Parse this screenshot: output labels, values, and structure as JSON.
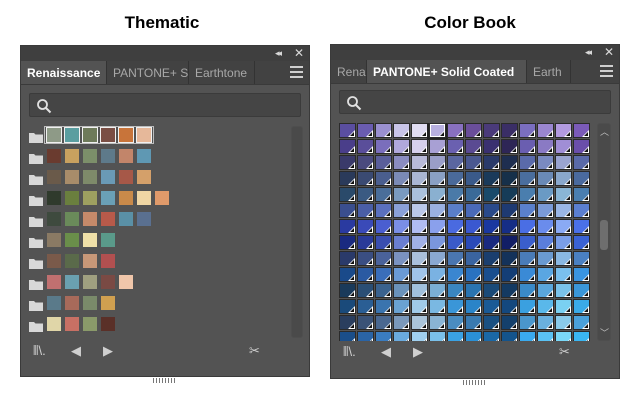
{
  "captions": {
    "left": "Thematic",
    "right": "Color Book"
  },
  "thematic": {
    "tabs": [
      "Renaissance",
      "PANTONE+ S",
      "Earthtone"
    ],
    "active_tab": 0,
    "icons": {
      "collapse": "double-chevron-icon",
      "close": "close-icon",
      "menu": "hamburger-menu-icon",
      "search": "search-icon"
    },
    "rows": [
      [
        "#8e9a87",
        "#5a9ea0",
        "#6e7a5a",
        "#7a4e44",
        "#c8743a",
        "#e6b89a"
      ],
      [
        "#6a3b2f",
        "#c8a15f",
        "#7c8f6a",
        "#5e7a8a",
        "#c2856a",
        "#5f98b3"
      ],
      [
        "#6a5a4a",
        "#a88c6a",
        "#7e8a6a",
        "#6a9ab6",
        "#a65848",
        "#d4a06a"
      ],
      [
        "#2f3a2c",
        "#6a7f3e",
        "#9ea060",
        "#6aa0b6",
        "#c98a4a",
        "#f0d6a4",
        "#e09a6a"
      ],
      [
        "#3e4a3e",
        "#6a8a5a",
        "#c68a6a",
        "#b85a4a",
        "#5a90a6",
        "#5a7090"
      ],
      [
        "#8a7a64",
        "#6a8e4a",
        "#f0e0a8",
        "#5a9a8a"
      ],
      [
        "#7a5a4a",
        "#5a6a4a",
        "#c89878",
        "#b25050"
      ],
      [
        "#c07070",
        "#6aa0b0",
        "#a0a080",
        "#7a4a44",
        "#f0c6aa"
      ],
      [
        "#5a7a8a",
        "#a86a5a",
        "#7a8a6a",
        "#d0a050"
      ],
      [
        "#e0d6a8",
        "#c87064",
        "#8a9a6a",
        "#5a3028"
      ]
    ]
  },
  "colorbook": {
    "tabs": [
      "Rena",
      "PANTONE+ Solid Coated",
      "Earth"
    ],
    "active_tab": 1,
    "icons": {
      "collapse": "double-chevron-icon",
      "close": "close-icon",
      "menu": "hamburger-menu-icon",
      "search": "search-icon"
    },
    "palette": [
      [
        "#5a4ea0",
        "#6a5cb0",
        "#9a90d0",
        "#c8c4e8",
        "#e0dcf2",
        "#b8b0e0",
        "#8870c0",
        "#6a4e9a",
        "#4a3a7a",
        "#3a2e66",
        "#7a6ec0",
        "#9a86d0",
        "#b29ae0",
        "#7a5ab8"
      ],
      [
        "#4a3e8a",
        "#5a4e9a",
        "#7a6ebc",
        "#b0a8dc",
        "#d6d0ec",
        "#a8a0d4",
        "#6a60b0",
        "#5a4a92",
        "#3a3070",
        "#2e2656",
        "#6a5eb0",
        "#8a7ac4",
        "#a08ed6",
        "#6a4eaa"
      ],
      [
        "#3a3a6a",
        "#4a4a7e",
        "#5a5e9a",
        "#8a8cc0",
        "#b8bad8",
        "#9a9ec8",
        "#5a66a0",
        "#4a5890",
        "#2a3a6a",
        "#1e2e50",
        "#5a6aaa",
        "#7a8ac0",
        "#9aa4d0",
        "#5a6aa8"
      ],
      [
        "#2a3a5a",
        "#3a4a72",
        "#4a5e8e",
        "#7a8ab6",
        "#aab6d4",
        "#8aa0c4",
        "#4a6a9a",
        "#3a5a8a",
        "#1a3a5a",
        "#16304a",
        "#4a6e9e",
        "#6a8ab6",
        "#8aa8cc",
        "#4a6a9e"
      ],
      [
        "#2a4a6a",
        "#3a5a82",
        "#4a6e9a",
        "#7a9ac0",
        "#aac0dc",
        "#8ab0d0",
        "#4a7aa8",
        "#3a6a98",
        "#1a4a6a",
        "#163c58",
        "#4a7eae",
        "#6a9ac4",
        "#8ab6d6",
        "#4a7eb0"
      ],
      [
        "#3a4e8e",
        "#4a5ea6",
        "#5a70be",
        "#8aa0d8",
        "#bac8ea",
        "#9ab0e0",
        "#5a7ec8",
        "#4a6ab8",
        "#2a4a8a",
        "#1e3a72",
        "#5a80cc",
        "#7a9ad8",
        "#9ab6e6",
        "#5a7ed0"
      ],
      [
        "#2a3aa0",
        "#3a4ab8",
        "#4a5ed0",
        "#7a8ee6",
        "#b0bcf2",
        "#8aa0ec",
        "#4a6ae0",
        "#3a58d0",
        "#1a38a0",
        "#162e86",
        "#4a6ee4",
        "#6a8cec",
        "#8aaaf4",
        "#4a70e8"
      ],
      [
        "#1a2a80",
        "#2a3a98",
        "#3a4eb0",
        "#6a7ed0",
        "#a0b0e6",
        "#7a96dc",
        "#3a5ac8",
        "#2a4ab8",
        "#1a2a80",
        "#121e66",
        "#3a5ecc",
        "#5a7edc",
        "#7a9ee8",
        "#3a62d4"
      ],
      [
        "#2a3a6a",
        "#3a4e82",
        "#4a629a",
        "#7a92c0",
        "#aac0dc",
        "#8aa8d0",
        "#4a76b0",
        "#3a64a0",
        "#1a3e6e",
        "#14325a",
        "#4a7cb8",
        "#6a9ad0",
        "#8ab8e2",
        "#4a80c2"
      ],
      [
        "#1a4a8a",
        "#2a5aa2",
        "#3a6eba",
        "#6a9ad6",
        "#a0c4ea",
        "#7ab2e2",
        "#3a86d0",
        "#2a72c0",
        "#1a4e8e",
        "#143e76",
        "#3a8ad6",
        "#5aa6e2",
        "#7ac0ee",
        "#3a94e0"
      ],
      [
        "#1a3a5a",
        "#2a4e74",
        "#3a628e",
        "#6a92ba",
        "#a0c0dc",
        "#7aaed4",
        "#3a86c0",
        "#2a74b0",
        "#1a4a78",
        "#143a62",
        "#3a8ac8",
        "#5aa6dc",
        "#7ac2ea",
        "#3a96d8"
      ],
      [
        "#1a4a7a",
        "#2a5e94",
        "#3a74ae",
        "#6aa2d2",
        "#a0cae8",
        "#7ab8e2",
        "#3a96d8",
        "#2a84c8",
        "#1a5a96",
        "#14487e",
        "#3aa0e0",
        "#5ab8ea",
        "#7ad0f2",
        "#3aaae8"
      ],
      [
        "#2a3e5e",
        "#3a5276",
        "#4a6890",
        "#7a98ba",
        "#aac4da",
        "#8ab4d4",
        "#4a8cc0",
        "#3a7ab0",
        "#1a5082",
        "#14406c",
        "#4a96cc",
        "#6ab0de",
        "#8acaea",
        "#4aa0da"
      ],
      [
        "#1a4e8a",
        "#2a64a6",
        "#3a7cc0",
        "#6aaade",
        "#a0d0f0",
        "#7ac0ea",
        "#3aa2e4",
        "#2a90d6",
        "#1a68a6",
        "#14548c",
        "#3aaaee",
        "#5ac2f4",
        "#7ad8f8",
        "#3ab6f2"
      ]
    ],
    "selected_index": [
      0,
      5
    ]
  }
}
